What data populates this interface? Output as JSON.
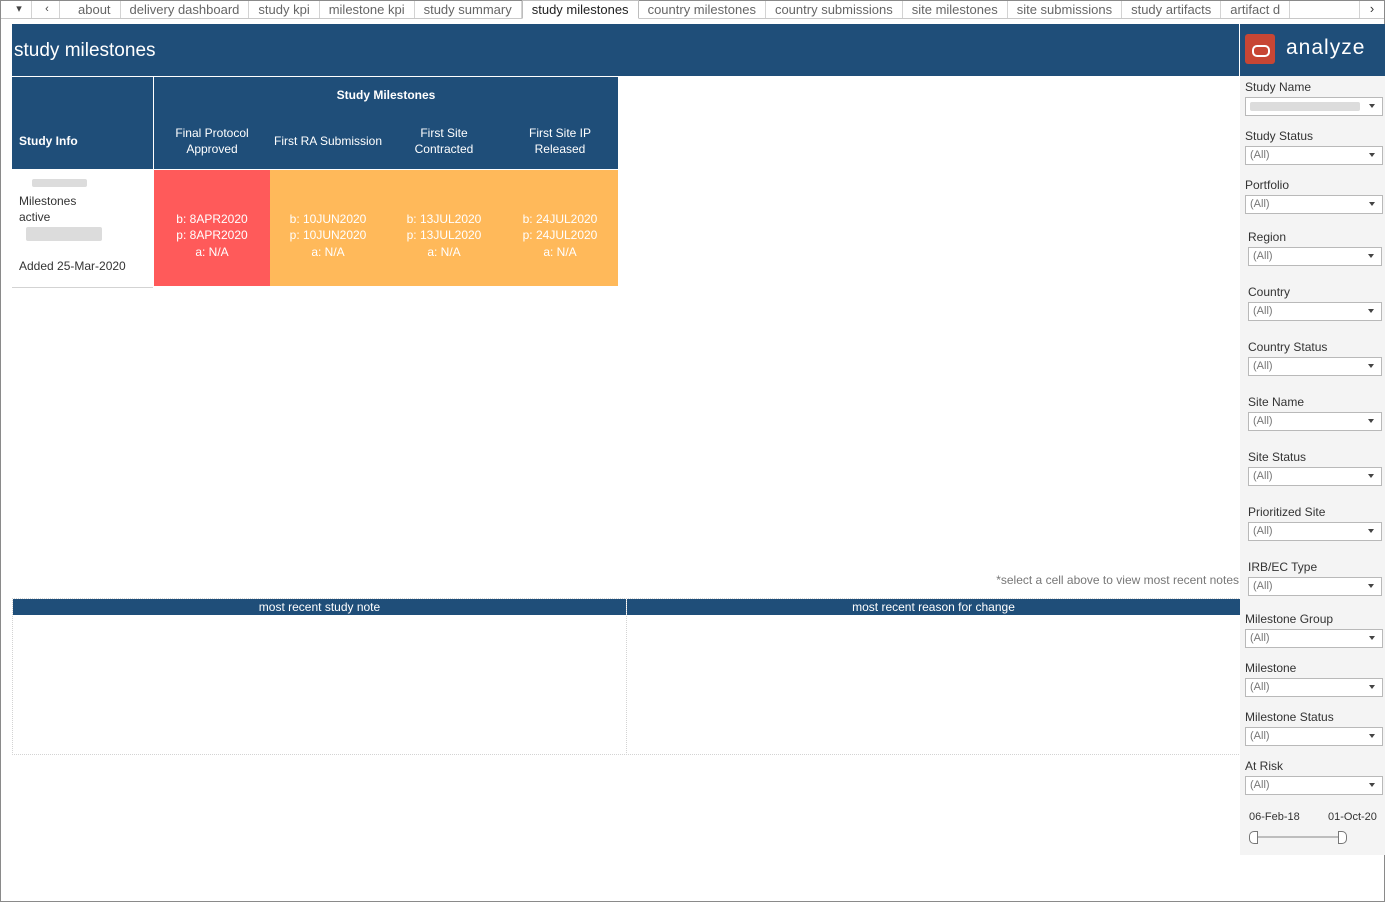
{
  "tabstrip": {
    "menu_icon": "▾",
    "prev_icon": "‹",
    "next_icon": "›",
    "tabs": [
      "about",
      "delivery dashboard",
      "study kpi",
      "milestone kpi",
      "study summary",
      "study milestones",
      "country milestones",
      "country submissions",
      "site milestones",
      "site submissions",
      "study artifacts",
      "artifact d"
    ]
  },
  "header": {
    "title": "study milestones"
  },
  "brand": {
    "name": "analyze",
    "logo_color": "#c74634"
  },
  "table": {
    "info_header": "Study Info",
    "group_header": "Study Milestones",
    "columns": [
      "Final Protocol\nApproved",
      "First RA Submission",
      "First Site\nContracted",
      "First Site IP\nReleased"
    ],
    "info_lines": [
      "Milestones",
      "active",
      "Added 25-Mar-2020"
    ],
    "cells": [
      {
        "b": "b: 8APR2020",
        "p": "p: 8APR2020",
        "a": "a: N/A",
        "color": "#ff5a5a"
      },
      {
        "b": "b: 10JUN2020",
        "p": "p: 10JUN2020",
        "a": "a: N/A",
        "color": "#ffb95a"
      },
      {
        "b": "b: 13JUL2020",
        "p": "p: 13JUL2020",
        "a": "a: N/A",
        "color": "#ffb95a"
      },
      {
        "b": "b: 24JUL2020",
        "p": "p: 24JUL2020",
        "a": "a: N/A",
        "color": "#ffb95a"
      }
    ]
  },
  "hint": "*select a cell above to view most recent notes",
  "notes": {
    "study_note_title": "most recent study note",
    "reason_title": "most recent reason for change"
  },
  "filters": [
    {
      "label": "Study Name",
      "value": ""
    },
    {
      "label": "Study Status",
      "value": "(All)"
    },
    {
      "label": "Portfolio",
      "value": "(All)"
    },
    {
      "label": "Region",
      "value": "(All)"
    },
    {
      "label": "Country",
      "value": "(All)"
    },
    {
      "label": "Country Status",
      "value": "(All)"
    },
    {
      "label": "Site Name",
      "value": "(All)"
    },
    {
      "label": "Site Status",
      "value": "(All)"
    },
    {
      "label": "Prioritized Site",
      "value": "(All)"
    },
    {
      "label": "IRB/EC Type",
      "value": "(All)"
    },
    {
      "label": "Milestone Group",
      "value": "(All)"
    },
    {
      "label": "Milestone",
      "value": "(All)"
    },
    {
      "label": "Milestone Status",
      "value": "(All)"
    },
    {
      "label": "At Risk",
      "value": "(All)"
    }
  ],
  "date_range": {
    "start": "06-Feb-18",
    "end": "01-Oct-20"
  },
  "colors": {
    "header": "#1f4e79",
    "red": "#ff5a5a",
    "orange": "#ffb95a"
  }
}
